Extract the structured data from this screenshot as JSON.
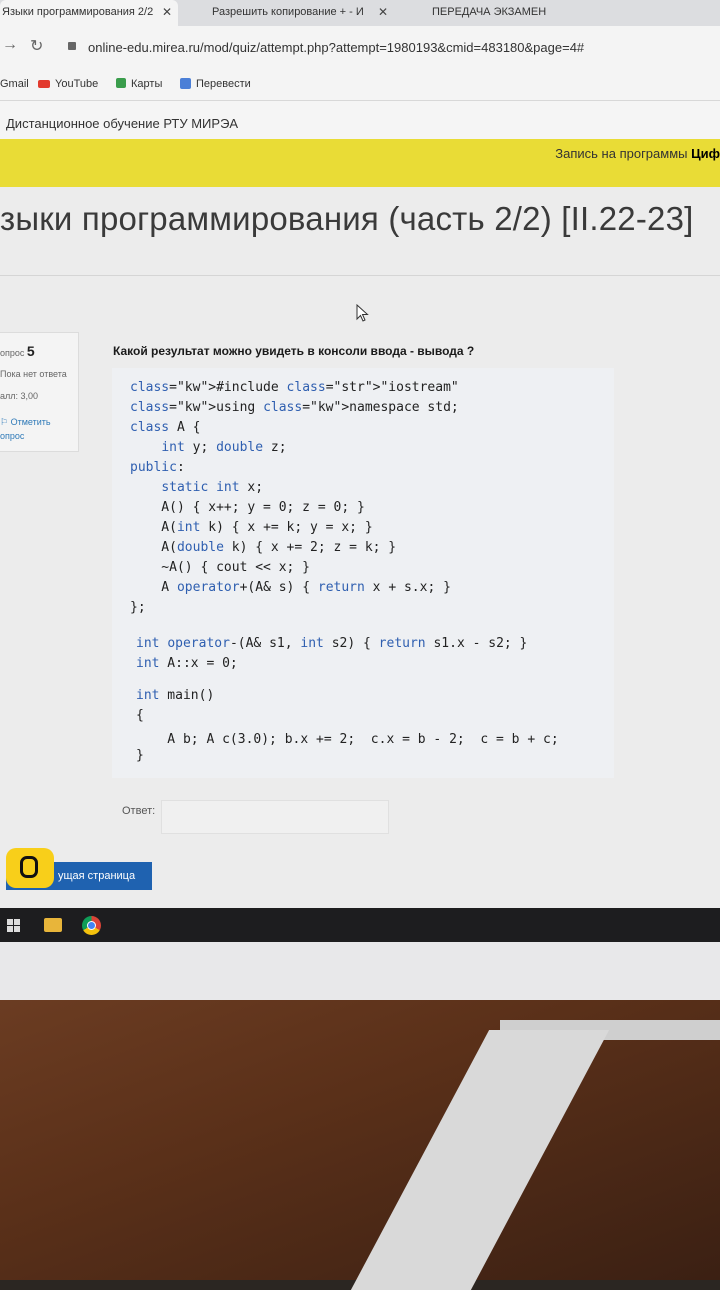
{
  "tabs": [
    {
      "label": "Языки программирования 2/2",
      "active": true
    },
    {
      "label": "Разрешить копирование + - И",
      "active": false
    },
    {
      "label": "ПЕРЕДАЧА ЭКЗАМЕН",
      "active": false
    }
  ],
  "address_bar": {
    "url": "online-edu.mirea.ru/mod/quiz/attempt.php?attempt=1980193&cmid=483180&page=4#"
  },
  "bookmarks": [
    "Gmail",
    "YouTube",
    "Карты",
    "Перевести"
  ],
  "site": {
    "name": "Дистанционное обучение РТУ МИРЭА"
  },
  "banner": {
    "text": "Запись на программы",
    "bold": "Циф"
  },
  "page_title": "зыки программирования (часть 2/2) [II.22-23]",
  "question_info": {
    "label": "опрос",
    "number": "5",
    "status": "Пока нет ответа",
    "grade": "алл: 3,00",
    "flag_line1": "Отметить",
    "flag_line2": "опрос"
  },
  "question": {
    "text": "Какой результат можно увидеть в консоли ввода - вывода ?"
  },
  "code": [
    "#include \"iostream\"",
    "using namespace std;",
    "class A {",
    "    int y; double z;",
    "public:",
    "    static int x;",
    "    A() { x++; y = 0; z = 0; }",
    "    A(int k) { x += k; y = x; }",
    "    A(double k) { x += 2; z = k; }",
    "    ~A() { cout << x; }",
    "    A operator+(A& s) { return x + s.x; }",
    "};",
    "int operator-(A& s1, int s2) { return s1.x - s2; }",
    "int A::x = 0;",
    "int main()",
    "{",
    "    A b; A c(3.0); b.x += 2;  c.x = b - 2;  c = b + c;",
    "}"
  ],
  "answer": {
    "label": "Ответ:",
    "value": ""
  },
  "next_button": {
    "label": "ущая страница"
  }
}
